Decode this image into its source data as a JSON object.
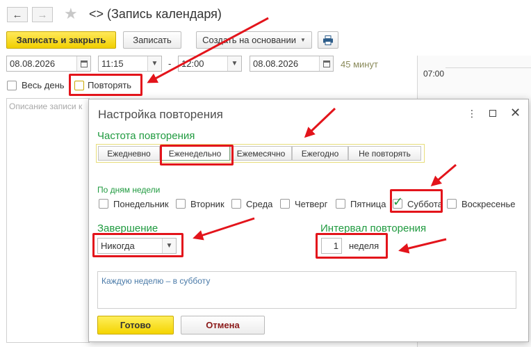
{
  "window": {
    "title": "<> (Запись календаря)",
    "back_icon": "arrow-left-icon",
    "forward_icon": "arrow-right-icon",
    "favorite_icon": "star-icon"
  },
  "toolbar": {
    "save_close_label": "Записать и закрыть",
    "save_label": "Записать",
    "create_based_label": "Создать на основании",
    "print_icon": "printer-icon"
  },
  "form": {
    "start_date": "08.08.2026",
    "start_time": "11:15",
    "time_separator": "-",
    "end_time": "12:00",
    "end_date": "08.08.2026",
    "duration": "45 минут",
    "all_day_label": "Весь день",
    "repeat_label": "Повторять",
    "description_placeholder": "Описание записи к"
  },
  "calendar_panel": {
    "time_0700": "07:00"
  },
  "dialog": {
    "title": "Настройка повторения",
    "menu_icon": "more-vertical-icon",
    "maximize_icon": "maximize-icon",
    "close_icon": "close-icon",
    "frequency": {
      "label": "Частота повторения",
      "options": [
        "Ежедневно",
        "Еженедельно",
        "Ежемесячно",
        "Ежегодно",
        "Не повторять"
      ],
      "selected": "Еженедельно"
    },
    "weekdays": {
      "label": "По дням недели",
      "days": [
        {
          "name": "Понедельник",
          "checked": false
        },
        {
          "name": "Вторник",
          "checked": false
        },
        {
          "name": "Среда",
          "checked": false
        },
        {
          "name": "Четверг",
          "checked": false
        },
        {
          "name": "Пятница",
          "checked": false
        },
        {
          "name": "Суббота",
          "checked": true
        },
        {
          "name": "Воскресенье",
          "checked": false
        }
      ]
    },
    "end": {
      "label": "Завершение",
      "value": "Никогда"
    },
    "interval": {
      "label": "Интервал повторения",
      "value": "1",
      "unit": "неделя"
    },
    "summary": "Каждую неделю – в субботу",
    "ok_label": "Готово",
    "cancel_label": "Отмена"
  },
  "annotation_color": "#e3141b",
  "accent_green": "#1f9a3f"
}
